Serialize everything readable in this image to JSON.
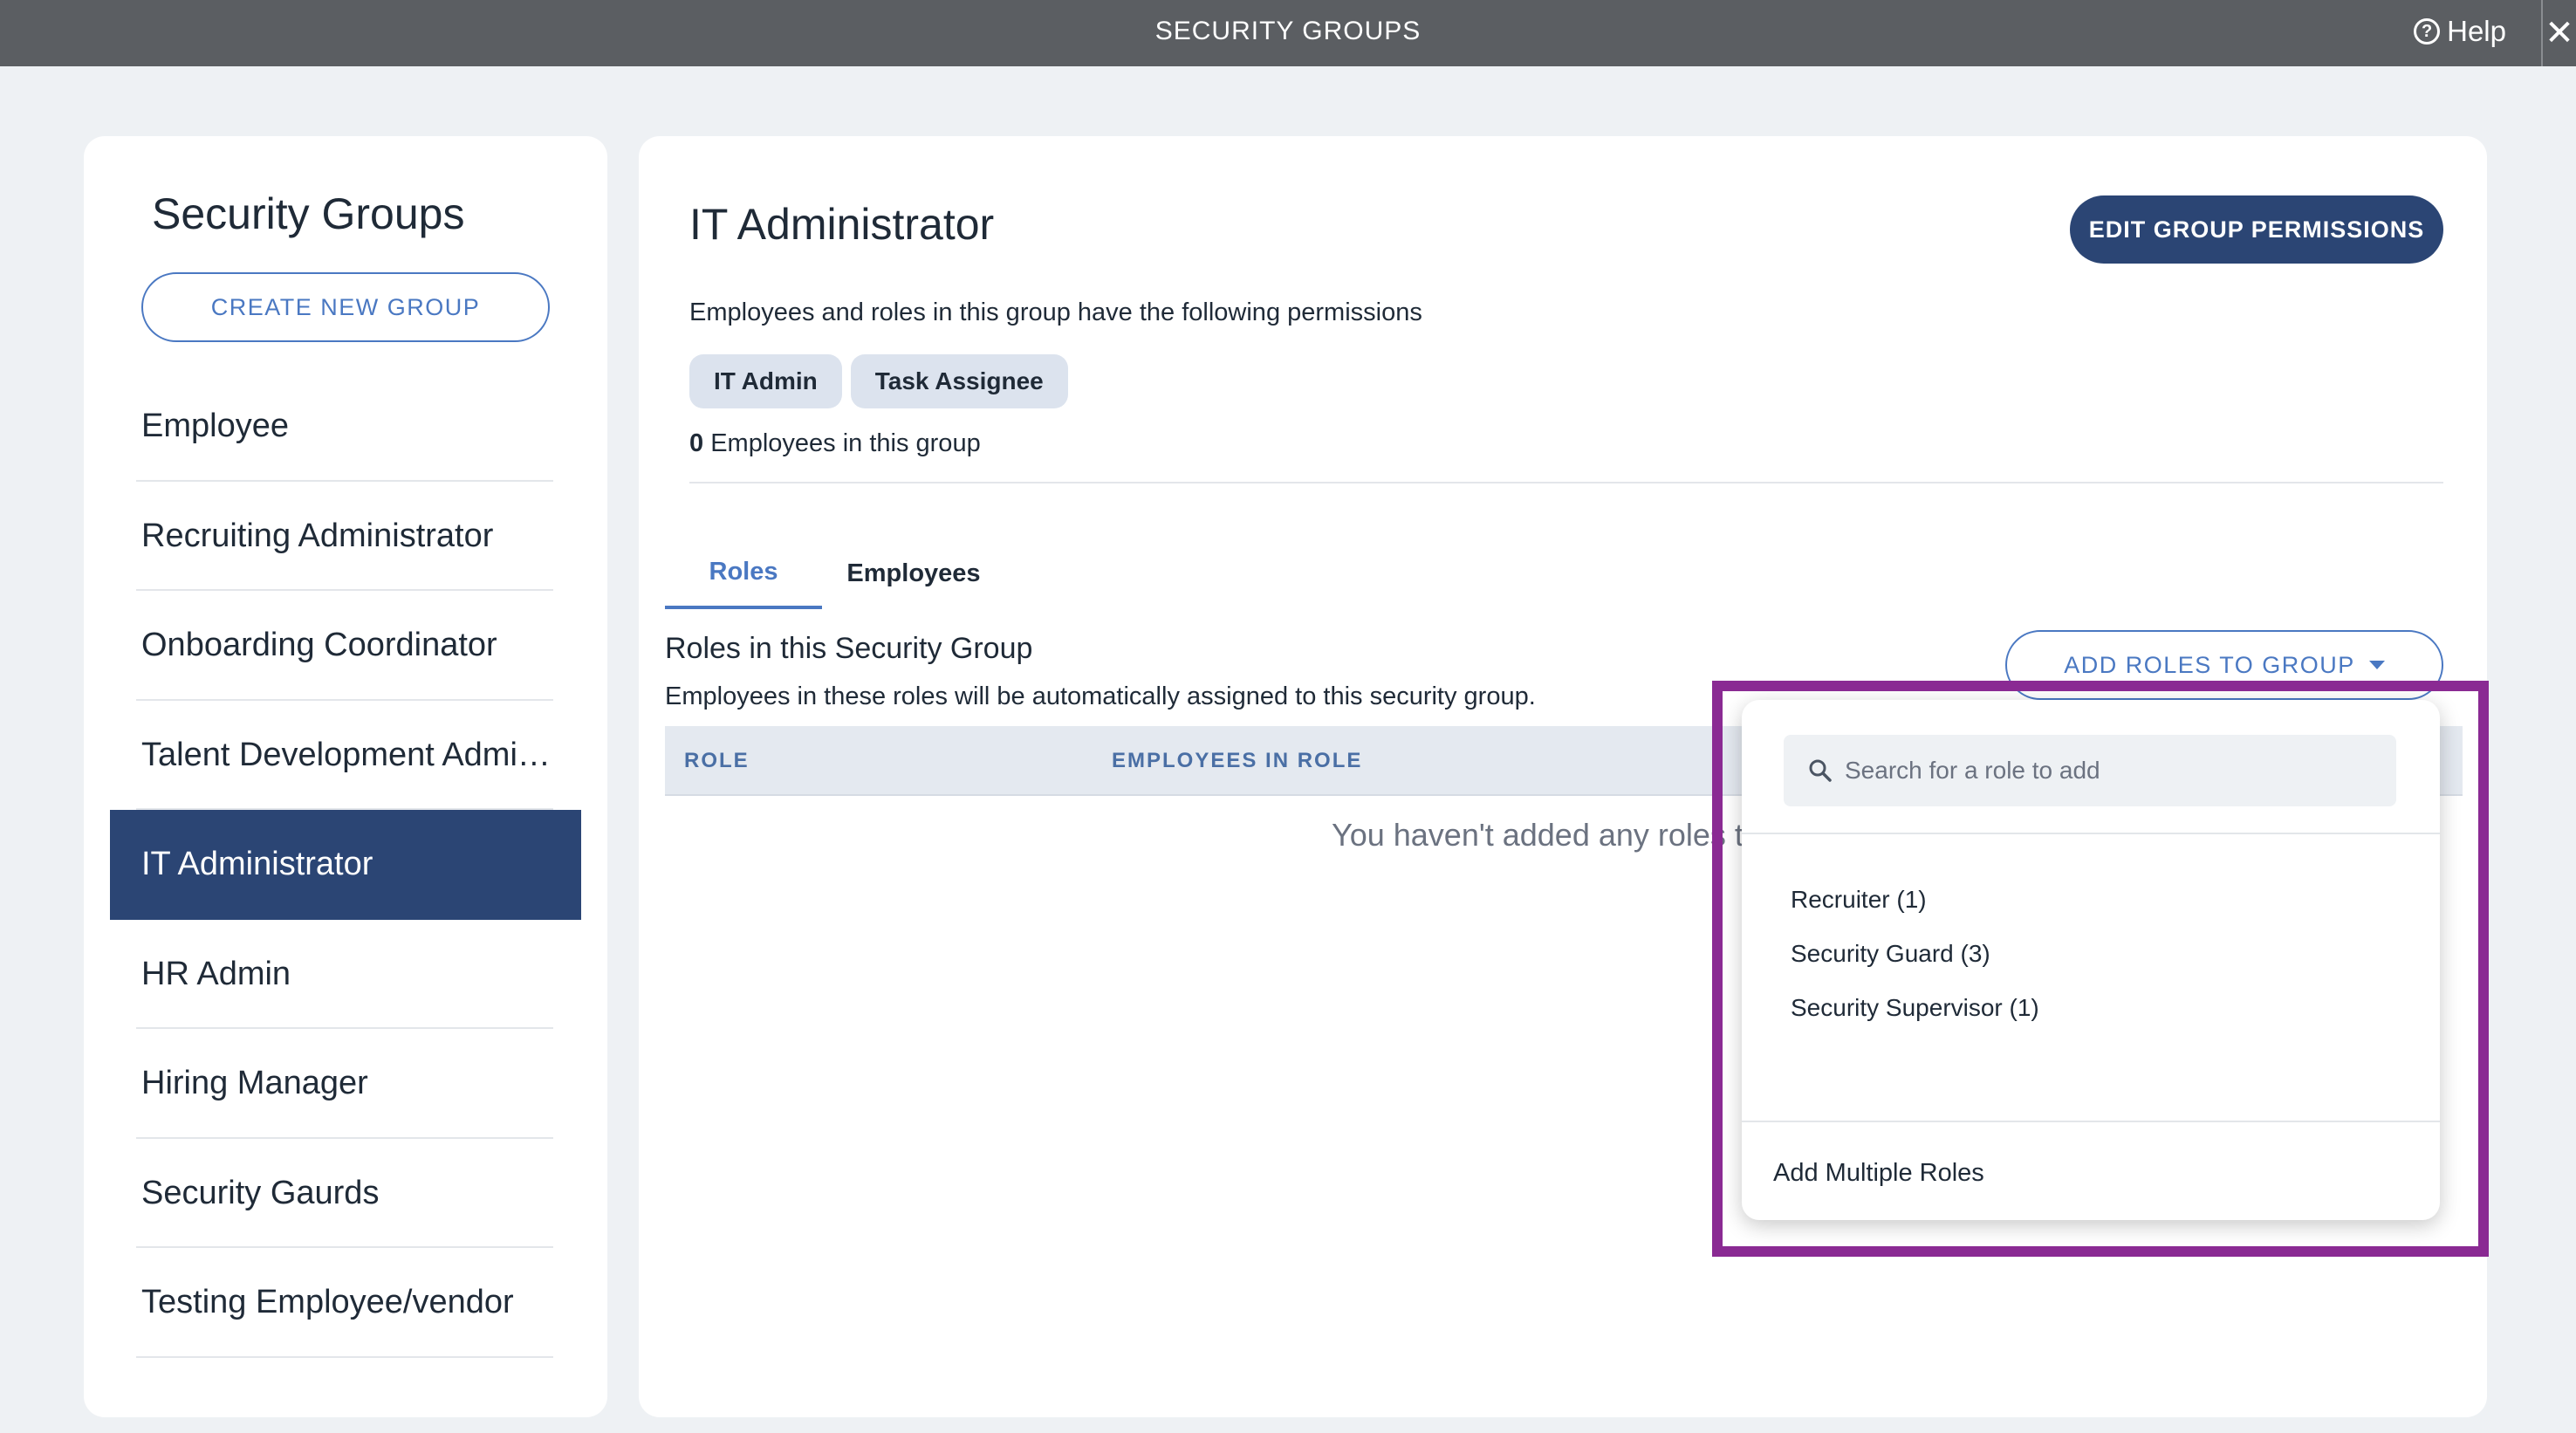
{
  "topbar": {
    "title": "SECURITY GROUPS",
    "help_label": "Help",
    "help_glyph": "?",
    "close_glyph": "✕"
  },
  "sidebar": {
    "title": "Security Groups",
    "create_button": "CREATE NEW GROUP",
    "items": [
      {
        "label": "Employee"
      },
      {
        "label": "Recruiting Administrator"
      },
      {
        "label": "Onboarding Coordinator"
      },
      {
        "label": "Talent Development Administrator"
      },
      {
        "label": "IT Administrator",
        "active": true
      },
      {
        "label": "HR Admin"
      },
      {
        "label": "Hiring Manager"
      },
      {
        "label": "Security Gaurds"
      },
      {
        "label": "Testing Employee/vendor"
      }
    ]
  },
  "main": {
    "group_title": "IT Administrator",
    "edit_button": "EDIT GROUP PERMISSIONS",
    "permissions_desc": "Employees and roles in this group have the following permissions",
    "chips": [
      "IT Admin",
      "Task Assignee"
    ],
    "employee_count": "0",
    "employee_count_suffix": " Employees in this group",
    "tabs": [
      {
        "label": "Roles",
        "active": true
      },
      {
        "label": "Employees",
        "active": false
      }
    ],
    "roles_title": "Roles in this Security Group",
    "roles_subtitle": "Employees in these roles will be automatically assigned to this security group.",
    "add_roles_button": "ADD ROLES TO GROUP",
    "table": {
      "col_role": "ROLE",
      "col_employees": "EMPLOYEES IN ROLE"
    },
    "empty_message": "You haven't added any roles to th"
  },
  "dropdown": {
    "search_placeholder": "Search for a role to add",
    "options": [
      "Recruiter (1)",
      "Security Guard (3)",
      "Security Supervisor (1)"
    ],
    "add_multiple": "Add Multiple Roles"
  },
  "colors": {
    "primary": "#2b4574",
    "accent": "#4a78c2",
    "highlight": "#8a2a93",
    "topbar": "#5b5e62"
  },
  "icons": {
    "help": "help-circle-icon",
    "close": "close-icon",
    "search": "search-icon",
    "caret": "caret-down-icon"
  }
}
